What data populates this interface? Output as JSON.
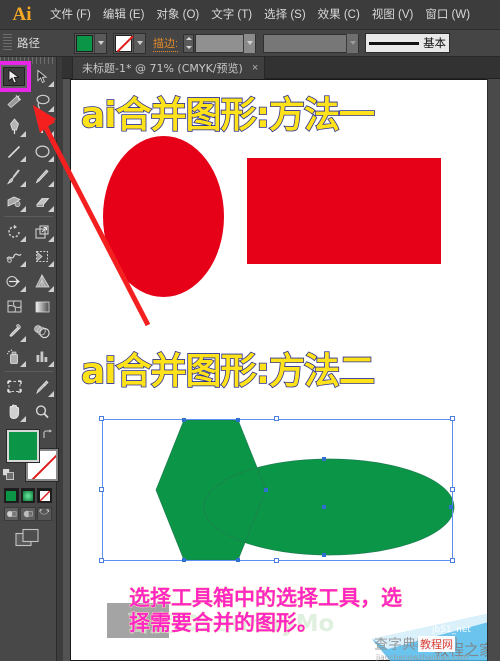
{
  "app": {
    "logo": "Ai",
    "accent_orange": "#f7a823",
    "chrome_bg": "#3c3c3c",
    "highlight_magenta": "#e726e7"
  },
  "menu": {
    "items": [
      {
        "label": "文件 (F)",
        "name": "menu-file"
      },
      {
        "label": "编辑 (E)",
        "name": "menu-edit"
      },
      {
        "label": "对象 (O)",
        "name": "menu-object"
      },
      {
        "label": "文字 (T)",
        "name": "menu-type"
      },
      {
        "label": "选择 (S)",
        "name": "menu-select"
      },
      {
        "label": "效果 (C)",
        "name": "menu-effect"
      },
      {
        "label": "视图 (V)",
        "name": "menu-view"
      },
      {
        "label": "窗口 (W)",
        "name": "menu-window"
      }
    ]
  },
  "controlbar": {
    "object_label": "路径",
    "fill_color": "#0a9646",
    "stroke_color": "none",
    "stroke_label": "描边:",
    "stroke_weight": "",
    "opacity_value": "",
    "brush_label": "基本"
  },
  "tab": {
    "title": "未标题-1* @ 71% (CMYK/预览)",
    "close": "×"
  },
  "toolbar": {
    "tools": [
      {
        "name": "selection-tool",
        "label": "选择工具",
        "selected": true
      },
      {
        "name": "direct-selection-tool",
        "label": "直接选择工具",
        "selected": false
      },
      {
        "name": "magic-wand-tool",
        "label": "魔棒工具",
        "selected": false
      },
      {
        "name": "lasso-tool",
        "label": "套索工具",
        "selected": false
      },
      {
        "name": "pen-tool",
        "label": "钢笔工具",
        "selected": false
      },
      {
        "name": "type-tool",
        "label": "文字工具",
        "selected": false
      },
      {
        "name": "line-segment-tool",
        "label": "直线段工具",
        "selected": false
      },
      {
        "name": "ellipse-tool",
        "label": "椭圆工具",
        "selected": false
      },
      {
        "name": "paintbrush-tool",
        "label": "画笔工具",
        "selected": false
      },
      {
        "name": "pencil-tool",
        "label": "铅笔工具",
        "selected": false
      },
      {
        "name": "blob-brush-tool",
        "label": "斑点画笔工具",
        "selected": false
      },
      {
        "name": "eraser-tool",
        "label": "橡皮擦工具",
        "selected": false
      },
      {
        "name": "rotate-tool",
        "label": "旋转工具",
        "selected": false
      },
      {
        "name": "scale-tool",
        "label": "比例缩放工具",
        "selected": false
      },
      {
        "name": "warp-tool",
        "label": "变形工具",
        "selected": false
      },
      {
        "name": "free-transform-tool",
        "label": "自由变换工具",
        "selected": false
      },
      {
        "name": "shape-builder-tool",
        "label": "形状生成器工具",
        "selected": false
      },
      {
        "name": "perspective-grid-tool",
        "label": "透视网格工具",
        "selected": false
      },
      {
        "name": "mesh-tool",
        "label": "网格工具",
        "selected": false
      },
      {
        "name": "gradient-tool",
        "label": "渐变工具",
        "selected": false
      },
      {
        "name": "eyedropper-tool",
        "label": "吸管工具",
        "selected": false
      },
      {
        "name": "blend-tool",
        "label": "混合工具",
        "selected": false
      },
      {
        "name": "symbol-sprayer-tool",
        "label": "符号喷枪工具",
        "selected": false
      },
      {
        "name": "column-graph-tool",
        "label": "柱形图工具",
        "selected": false
      },
      {
        "name": "artboard-tool",
        "label": "画板工具",
        "selected": false
      },
      {
        "name": "slice-tool",
        "label": "切片工具",
        "selected": false
      },
      {
        "name": "hand-tool",
        "label": "抓手工具",
        "selected": false
      },
      {
        "name": "zoom-tool",
        "label": "缩放工具",
        "selected": false
      }
    ],
    "fill_color": "#0a9646",
    "stroke_color": "none",
    "color_modes": [
      {
        "name": "color-mode-color",
        "label": "颜色"
      },
      {
        "name": "color-mode-gradient",
        "label": "渐变"
      },
      {
        "name": "color-mode-none",
        "label": "无"
      }
    ],
    "draw_modes": [
      {
        "name": "draw-normal",
        "label": "正常绘图"
      },
      {
        "name": "draw-behind",
        "label": "背面绘图"
      },
      {
        "name": "draw-inside",
        "label": "内部绘图"
      }
    ],
    "screen_mode": "更改屏幕模式"
  },
  "canvas": {
    "titles": [
      {
        "text": "ai合并图形:方法一",
        "name": "artwork-title-method-one"
      },
      {
        "text": "ai合并图形:方法二",
        "name": "artwork-title-method-two"
      }
    ],
    "title_fill": "#ffe21a",
    "title_stroke": "#2a2f8f",
    "shapes": [
      {
        "name": "red-ellipse",
        "type": "ellipse",
        "color": "#e60018"
      },
      {
        "name": "red-rectangle",
        "type": "rectangle",
        "color": "#e60018"
      },
      {
        "name": "green-hexagon",
        "type": "hexagon",
        "color": "#0b9547"
      },
      {
        "name": "green-ellipse",
        "type": "ellipse",
        "color": "#0b9547"
      }
    ],
    "selection_color": "#5b8ff0",
    "annotation_lines": [
      "选择工具箱中的选择工具，选",
      "择需要合并的图形。"
    ],
    "annotation_color": "#ff26c4",
    "overlay_author": "百度ID: sunnyMo",
    "arrow_color": "#f42020"
  },
  "watermark": {
    "line1": "jb51_net",
    "line2": "查字典教程网",
    "line3": "教程之家",
    "line4": "jiaochengwzhaidian.com",
    "badge": "教程网"
  }
}
